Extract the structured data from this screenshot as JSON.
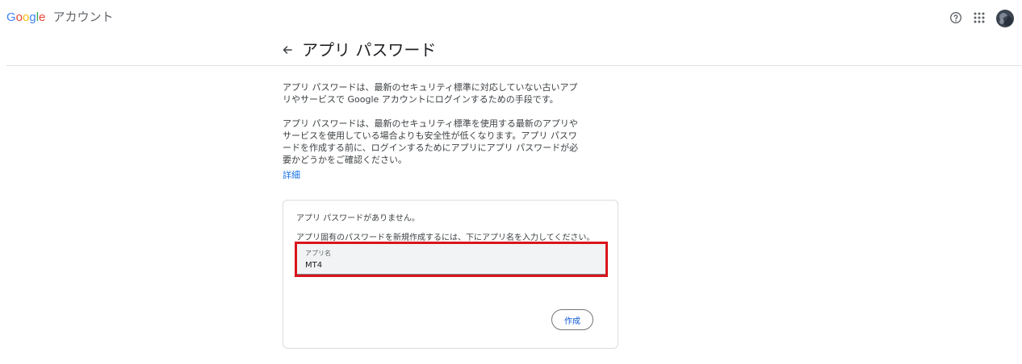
{
  "header": {
    "logo_letters": [
      {
        "char": "G",
        "color": "#4285F4"
      },
      {
        "char": "o",
        "color": "#EA4335"
      },
      {
        "char": "o",
        "color": "#FBBC05"
      },
      {
        "char": "g",
        "color": "#4285F4"
      },
      {
        "char": "l",
        "color": "#34A853"
      },
      {
        "char": "e",
        "color": "#EA4335"
      }
    ],
    "app_name": "アカウント",
    "help_icon": "help-circle-icon",
    "apps_icon": "apps-grid-icon",
    "avatar_icon": "user-avatar"
  },
  "page": {
    "back_icon": "arrow-left-icon",
    "title": "アプリ パスワード",
    "description_1": "アプリ パスワードは、最新のセキュリティ標準に対応していない古いアプリやサービスで Google アカウントにログインするための手段です。",
    "description_2": "アプリ パスワードは、最新のセキュリティ標準を使用する最新のアプリやサービスを使用している場合よりも安全性が低くなります。アプリ パスワードを作成する前に、ログインするためにアプリにアプリ パスワードが必要かどうかをご確認ください。",
    "details_link": "詳細"
  },
  "card": {
    "no_passwords": "アプリ パスワードがありません。",
    "instruction": "アプリ固有のパスワードを新規作成するには、下にアプリ名を入力してください。",
    "field_label": "アプリ名",
    "field_value": "MT4",
    "create_button": "作成"
  },
  "colors": {
    "accent_blue": "#1a73e8",
    "highlight_red": "#d9141c",
    "button_text": "#0b57d0"
  }
}
